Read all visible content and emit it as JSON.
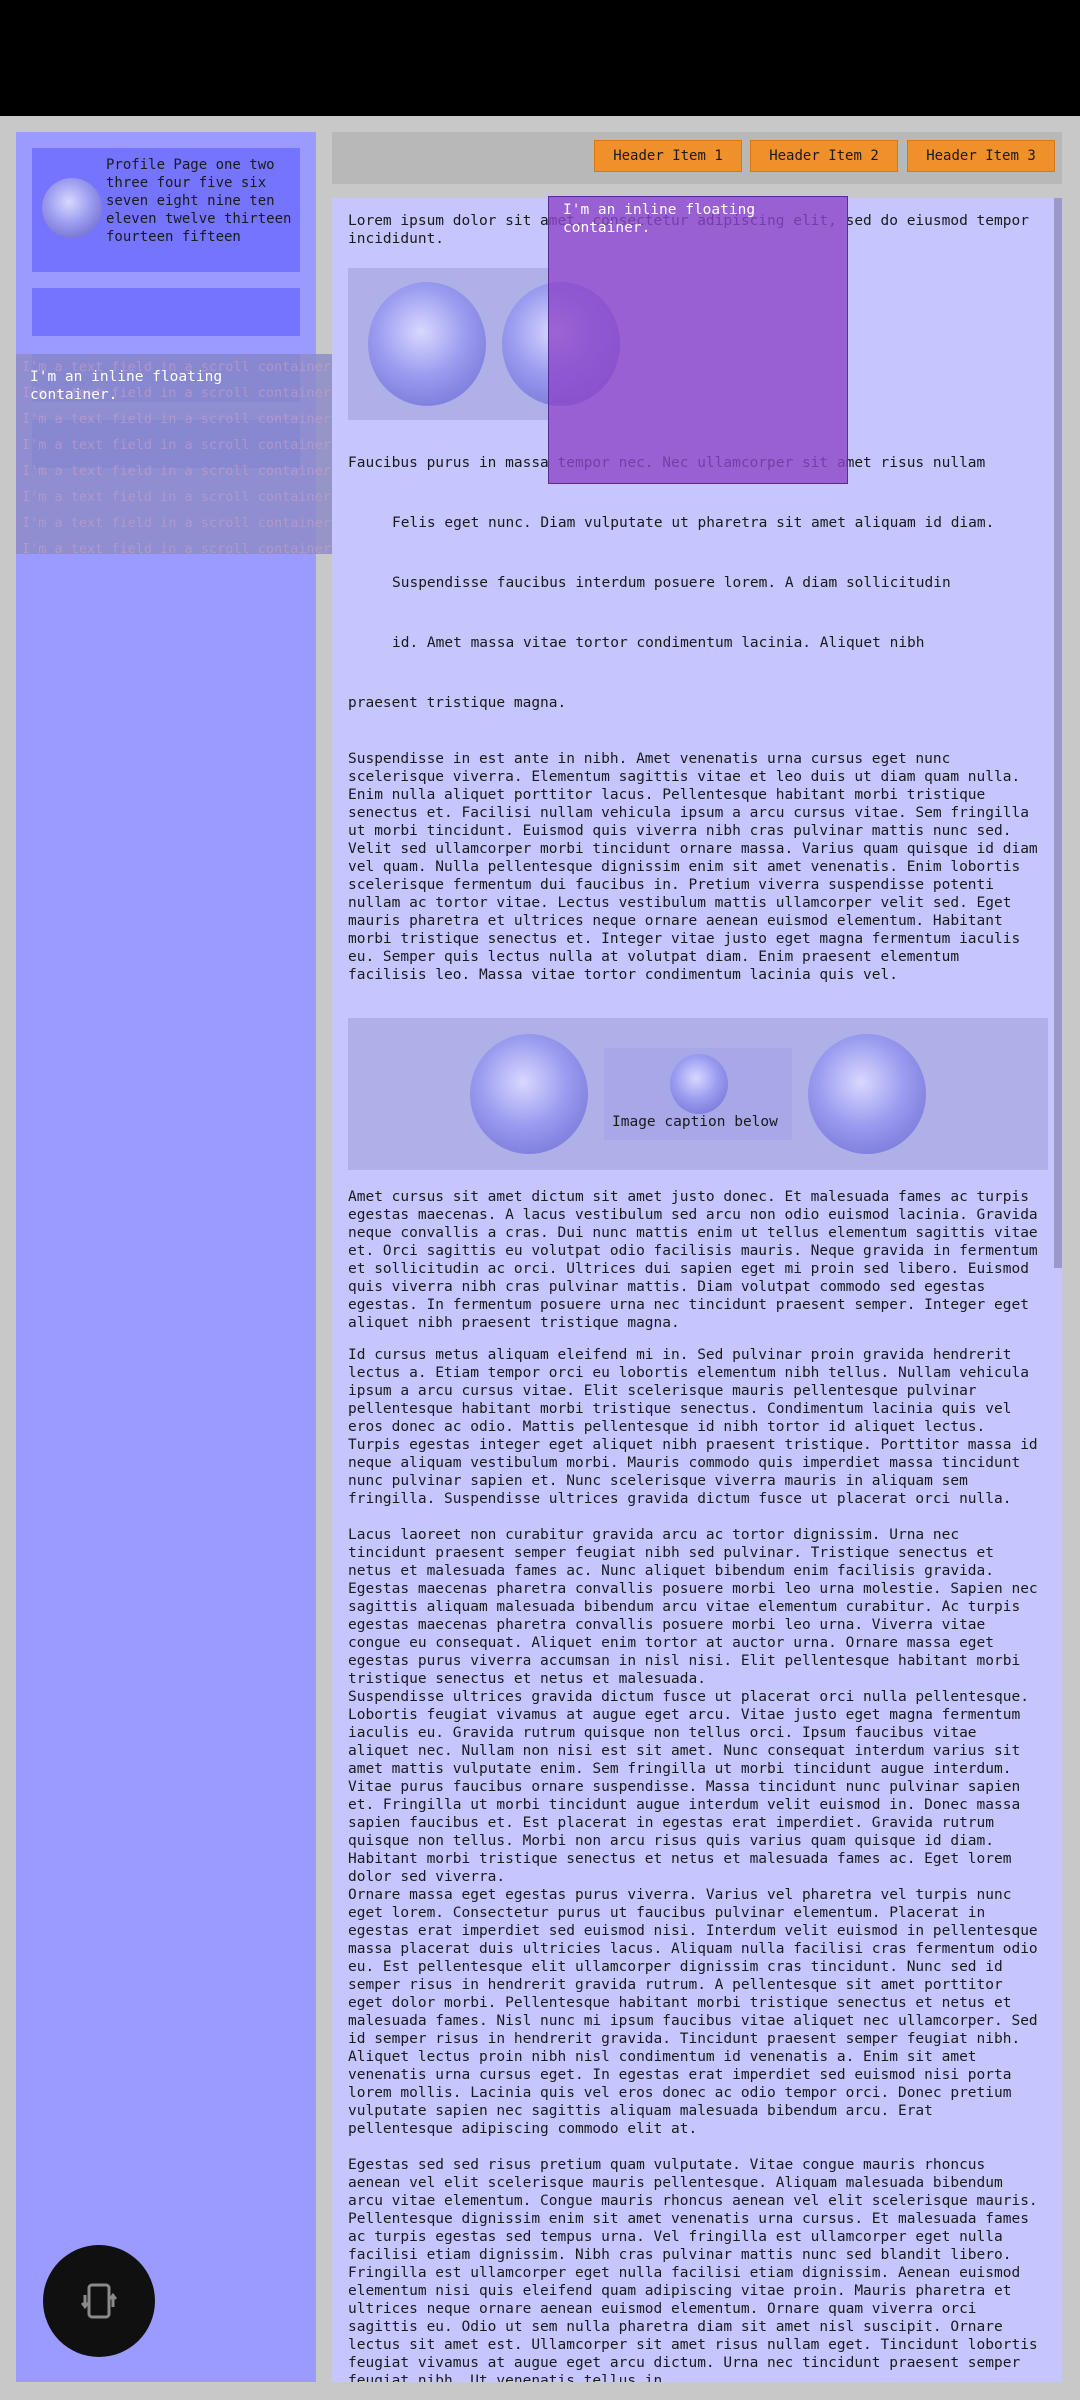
{
  "sidebar": {
    "profile_text": "Profile Page one two three four five six seven eight nine ten eleven twelve thirteen fourteen fifteen",
    "scroll_field_line": "I'm a text field in a scroll container.",
    "inline_floating_label": "I'm an inline floating container."
  },
  "header": {
    "items": [
      "Header Item 1",
      "Header Item 2",
      "Header Item 3"
    ]
  },
  "main": {
    "intro": "Lorem ipsum dolor sit amet, consectetur adipiscing elit, sed do eiusmod tempor incididunt.",
    "floating_label": "I'm an inline floating container.",
    "line1": "Faucibus purus in massa tempor nec. Nec ullamcorper sit amet risus nullam",
    "line2": "Felis eget nunc. Diam vulputate ut pharetra sit amet aliquam id diam.",
    "line3": "Suspendisse faucibus interdum posuere lorem. A diam sollicitudin",
    "line4": "id. Amet massa vitae tortor condimentum lacinia. Aliquet nibh",
    "line5": "praesent tristique magna.",
    "para_a": "Suspendisse in est ante in nibh. Amet venenatis urna cursus eget nunc scelerisque viverra. Elementum sagittis vitae et leo duis ut diam quam nulla. Enim nulla aliquet porttitor lacus. Pellentesque habitant morbi tristique senectus et. Facilisi nullam vehicula ipsum a arcu cursus vitae. Sem fringilla ut morbi tincidunt. Euismod quis viverra nibh cras pulvinar mattis nunc sed. Velit sed ullamcorper morbi tincidunt ornare massa. Varius quam quisque id diam vel quam. Nulla pellentesque dignissim enim sit amet venenatis. Enim lobortis scelerisque fermentum dui faucibus in. Pretium viverra suspendisse potenti nullam ac tortor vitae. Lectus vestibulum mattis ullamcorper velit sed. Eget mauris pharetra et ultrices neque ornare aenean euismod elementum. Habitant morbi tristique senectus et. Integer vitae justo eget magna fermentum iaculis eu. Semper quis lectus nulla at volutpat diam. Enim praesent elementum facilisis leo. Massa vitae tortor condimentum lacinia quis vel.",
    "image_caption": "Image caption below",
    "para_b": "Amet cursus sit amet dictum sit amet justo donec. Et malesuada fames ac turpis egestas maecenas. A lacus vestibulum sed arcu non odio euismod lacinia. Gravida neque convallis a cras. Dui nunc mattis enim ut tellus elementum sagittis vitae et. Orci sagittis eu volutpat odio facilisis mauris. Neque gravida in fermentum et sollicitudin ac orci. Ultrices dui sapien eget mi proin sed libero. Euismod quis viverra nibh cras pulvinar mattis. Diam volutpat commodo sed egestas egestas. In fermentum posuere urna nec tincidunt praesent semper. Integer eget aliquet nibh praesent tristique magna.",
    "para_c": "Id cursus metus aliquam eleifend mi in. Sed pulvinar proin gravida hendrerit lectus a. Etiam tempor orci eu lobortis elementum nibh tellus. Nullam vehicula ipsum a arcu cursus vitae. Elit scelerisque mauris pellentesque pulvinar pellentesque habitant morbi tristique senectus. Condimentum lacinia quis vel eros donec ac odio. Mattis pellentesque id nibh tortor id aliquet lectus. Turpis egestas integer eget aliquet nibh praesent tristique. Porttitor massa id neque aliquam vestibulum morbi. Mauris commodo quis imperdiet massa tincidunt nunc pulvinar sapien et. Nunc scelerisque viverra mauris in aliquam sem fringilla. Suspendisse ultrices gravida dictum fusce ut placerat orci nulla.",
    "para_d": "Lacus laoreet non curabitur gravida arcu ac tortor dignissim. Urna nec tincidunt praesent semper feugiat nibh sed pulvinar. Tristique senectus et netus et malesuada fames ac. Nunc aliquet bibendum enim facilisis gravida. Egestas maecenas pharetra convallis posuere morbi leo urna molestie. Sapien nec sagittis aliquam malesuada bibendum arcu vitae elementum curabitur. Ac turpis egestas maecenas pharetra convallis posuere morbi leo urna. Viverra vitae congue eu consequat. Aliquet enim tortor at auctor urna. Ornare massa eget egestas purus viverra accumsan in nisl nisi. Elit pellentesque habitant morbi tristique senectus et netus et malesuada.",
    "para_e": "Suspendisse ultrices gravida dictum fusce ut placerat orci nulla pellentesque. Lobortis feugiat vivamus at augue eget arcu. Vitae justo eget magna fermentum iaculis eu. Gravida rutrum quisque non tellus orci. Ipsum faucibus vitae aliquet nec. Nullam non nisi est sit amet. Nunc consequat interdum varius sit amet mattis vulputate enim. Sem fringilla ut morbi tincidunt augue interdum. Vitae purus faucibus ornare suspendisse. Massa tincidunt nunc pulvinar sapien et. Fringilla ut morbi tincidunt augue interdum velit euismod in. Donec massa sapien faucibus et. Est placerat in egestas erat imperdiet. Gravida rutrum quisque non tellus. Morbi non arcu risus quis varius quam quisque id diam. Habitant morbi tristique senectus et netus et malesuada fames ac. Eget lorem dolor sed viverra.",
    "para_f": "Ornare massa eget egestas purus viverra. Varius vel pharetra vel turpis nunc eget lorem. Consectetur purus ut faucibus pulvinar elementum. Placerat in egestas erat imperdiet sed euismod nisi. Interdum velit euismod in pellentesque massa placerat duis ultricies lacus. Aliquam nulla facilisi cras fermentum odio eu. Est pellentesque elit ullamcorper dignissim cras tincidunt. Nunc sed id semper risus in hendrerit gravida rutrum. A pellentesque sit amet porttitor eget dolor morbi. Pellentesque habitant morbi tristique senectus et netus et malesuada fames. Nisl nunc mi ipsum faucibus vitae aliquet nec ullamcorper. Sed id semper risus in hendrerit gravida. Tincidunt praesent semper feugiat nibh. Aliquet lectus proin nibh nisl condimentum id venenatis a. Enim sit amet venenatis urna cursus eget. In egestas erat imperdiet sed euismod nisi porta lorem mollis. Lacinia quis vel eros donec ac odio tempor orci. Donec pretium vulputate sapien nec sagittis aliquam malesuada bibendum arcu. Erat pellentesque adipiscing commodo elit at.",
    "para_g": "Egestas sed sed risus pretium quam vulputate. Vitae congue mauris rhoncus aenean vel elit scelerisque mauris pellentesque. Aliquam malesuada bibendum arcu vitae elementum. Congue mauris rhoncus aenean vel elit scelerisque mauris. Pellentesque dignissim enim sit amet venenatis urna cursus. Et malesuada fames ac turpis egestas sed tempus urna. Vel fringilla est ullamcorper eget nulla facilisi etiam dignissim. Nibh cras pulvinar mattis nunc sed blandit libero. Fringilla est ullamcorper eget nulla facilisi etiam dignissim. Aenean euismod elementum nisi quis eleifend quam adipiscing vitae proin. Mauris pharetra et ultrices neque ornare aenean euismod elementum. Ornare quam viverra orci sagittis eu. Odio ut sem nulla pharetra diam sit amet nisl suscipit. Ornare lectus sit amet est. Ullamcorper sit amet risus nullam eget. Tincidunt lobortis feugiat vivamus at augue eget arcu dictum. Urna nec tincidunt praesent semper feugiat nibh. Ut venenatis tellus in"
  },
  "fab": {
    "icon": "screen-rotation-icon"
  },
  "colors": {
    "topbar": "#000000",
    "sidebar": "#9a9aff",
    "sidebar_block": "#7474ff",
    "content": "#c6c6ff",
    "header_button": "#f0902a",
    "floating_overlay": "#8c46c8"
  }
}
